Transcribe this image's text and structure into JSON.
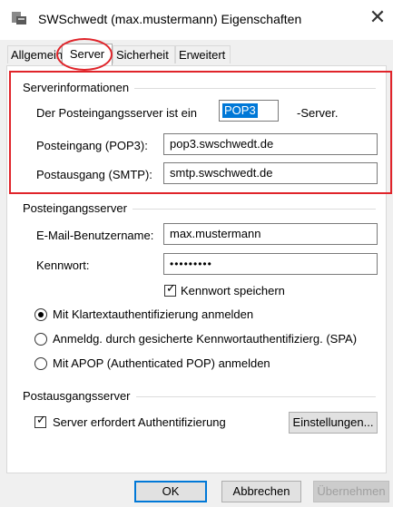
{
  "window": {
    "title": "SWSchwedt (max.mustermann) Eigenschaften",
    "close_glyph": "✕"
  },
  "tabs": [
    {
      "label": "Allgemein",
      "active": false
    },
    {
      "label": "Server",
      "active": true
    },
    {
      "label": "Sicherheit",
      "active": false
    },
    {
      "label": "Erweitert",
      "active": false
    }
  ],
  "server_info": {
    "group_label": "Serverinformationen",
    "incoming_prefix": "Der Posteingangsserver ist ein",
    "incoming_type": "POP3",
    "incoming_suffix": "-Server.",
    "incoming_label": "Posteingang (POP3):",
    "incoming_value": "pop3.swschwedt.de",
    "outgoing_label": "Postausgang (SMTP):",
    "outgoing_value": "smtp.swschwedt.de"
  },
  "incoming_server": {
    "group_label": "Posteingangsserver",
    "username_label": "E-Mail-Benutzername:",
    "username_value": "max.mustermann",
    "password_label": "Kennwort:",
    "password_value": "•••••••••",
    "remember_password_label": "Kennwort speichern",
    "remember_password_checked": true,
    "auth_options": [
      {
        "label": "Mit Klartextauthentifizierung anmelden",
        "selected": true
      },
      {
        "label": "Anmeldg. durch gesicherte Kennwortauthentifizierg. (SPA)",
        "selected": false
      },
      {
        "label": "Mit APOP (Authenticated POP) anmelden",
        "selected": false
      }
    ]
  },
  "outgoing_server": {
    "group_label": "Postausgangsserver",
    "requires_auth_label": "Server erfordert Authentifizierung",
    "requires_auth_checked": true,
    "settings_button": "Einstellungen..."
  },
  "buttons": {
    "ok": "OK",
    "cancel": "Abbrechen",
    "apply": "Übernehmen"
  },
  "colors": {
    "highlight": "#e0242a",
    "selection": "#0078d7"
  }
}
